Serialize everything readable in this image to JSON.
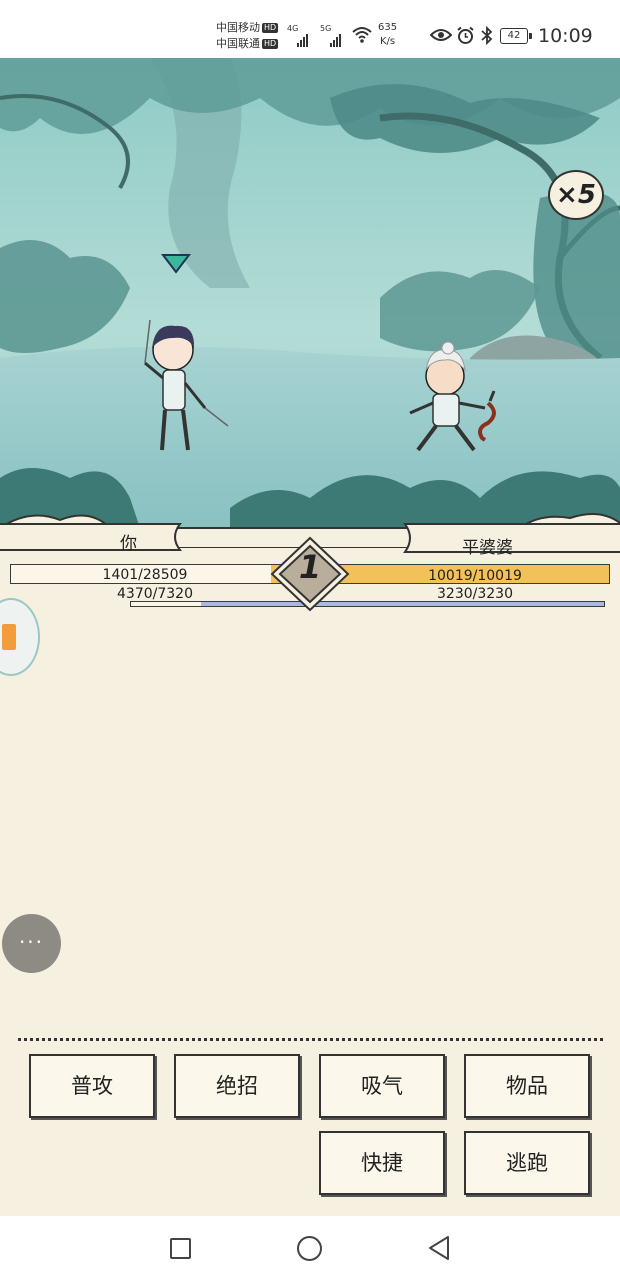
{
  "status_bar": {
    "carrier_1": "中国移动",
    "carrier_2": "中国联通",
    "hd_badge": "HD",
    "network_4g": "4G",
    "network_5g": "5G",
    "speed_value": "635",
    "speed_unit": "K/s",
    "battery": "42",
    "time": "10:09",
    "icons": [
      "eye-icon",
      "alarm-icon",
      "bluetooth-icon",
      "wifi-icon"
    ]
  },
  "battle": {
    "speed_multiplier": "×5",
    "turn": "1",
    "player": {
      "name": "你",
      "hp_text": "1401/28509",
      "hp_current": 1401,
      "hp_max": 28509,
      "mp_text": "4370/7320",
      "mp_current": 4370,
      "mp_max": 7320
    },
    "enemy": {
      "name": "平婆婆",
      "hp_text": "10019/10019",
      "hp_current": 10019,
      "hp_max": 10019,
      "mp_text": "3230/3230",
      "mp_current": 3230,
      "mp_max": 3230
    }
  },
  "actions": {
    "attack": "普攻",
    "ultimate": "绝招",
    "breathe": "吸气",
    "items": "物品",
    "quick": "快捷",
    "flee": "逃跑"
  },
  "float_menu_label": "···",
  "colors": {
    "parchment": "#f6f0e0",
    "hp_fill": "#f3c15a",
    "mp_fill": "#aab8e6",
    "scene_sky": "#7fc0bb",
    "ink": "#222222"
  }
}
